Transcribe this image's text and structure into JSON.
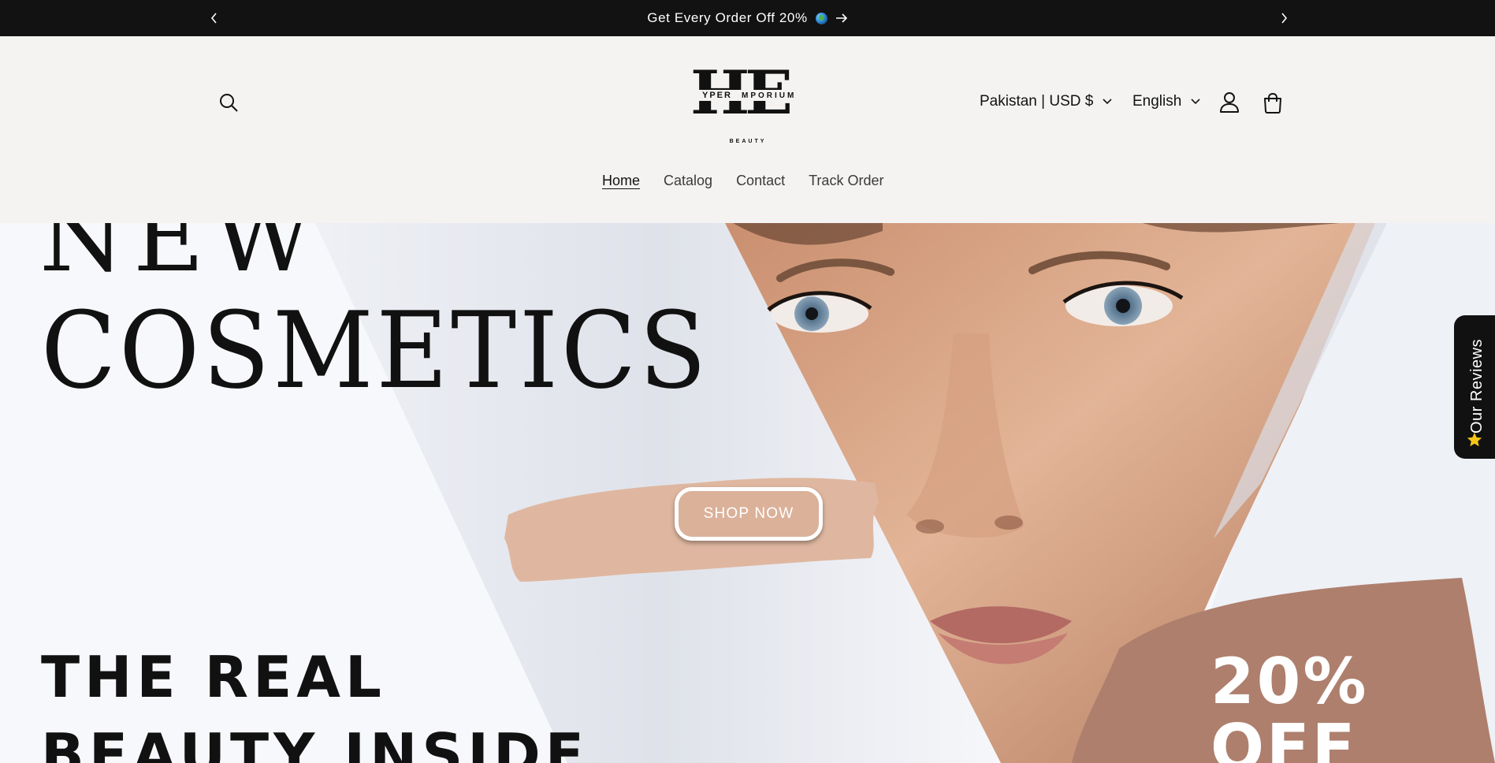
{
  "announcement": {
    "message": "Get Every Order Off 20%",
    "prev_icon": "chevron-left-icon",
    "next_icon": "chevron-right-icon",
    "globe_icon": "globe-emoji-icon",
    "arrow_icon": "arrow-right-icon"
  },
  "header": {
    "logo": {
      "letters": "HE",
      "line_left": "YPER",
      "line_right": "MPORIUM",
      "tagline": "BEAUTY"
    },
    "country_selector": "Pakistan | USD $",
    "language_selector": "English",
    "icons": [
      "search-icon",
      "account-icon",
      "cart-icon"
    ]
  },
  "nav": {
    "items": [
      {
        "label": "Home",
        "active": true
      },
      {
        "label": "Catalog",
        "active": false
      },
      {
        "label": "Contact",
        "active": false
      },
      {
        "label": "Track Order",
        "active": false
      }
    ]
  },
  "hero": {
    "headline_top": "NEW",
    "headline_main": "COSMETICS",
    "cta_label": "SHOP NOW",
    "tagline_line1": "THE REAL",
    "tagline_line2": "BEAUTY INSIDE",
    "promo_line1": "20%",
    "promo_line2": "OFF",
    "colors": {
      "brush_light": "#dfb7a0",
      "brush_dark": "#ae7f6d",
      "skin": "#d9a586"
    }
  },
  "reviews_tab": {
    "label": "Our Reviews",
    "icon": "star-icon"
  }
}
